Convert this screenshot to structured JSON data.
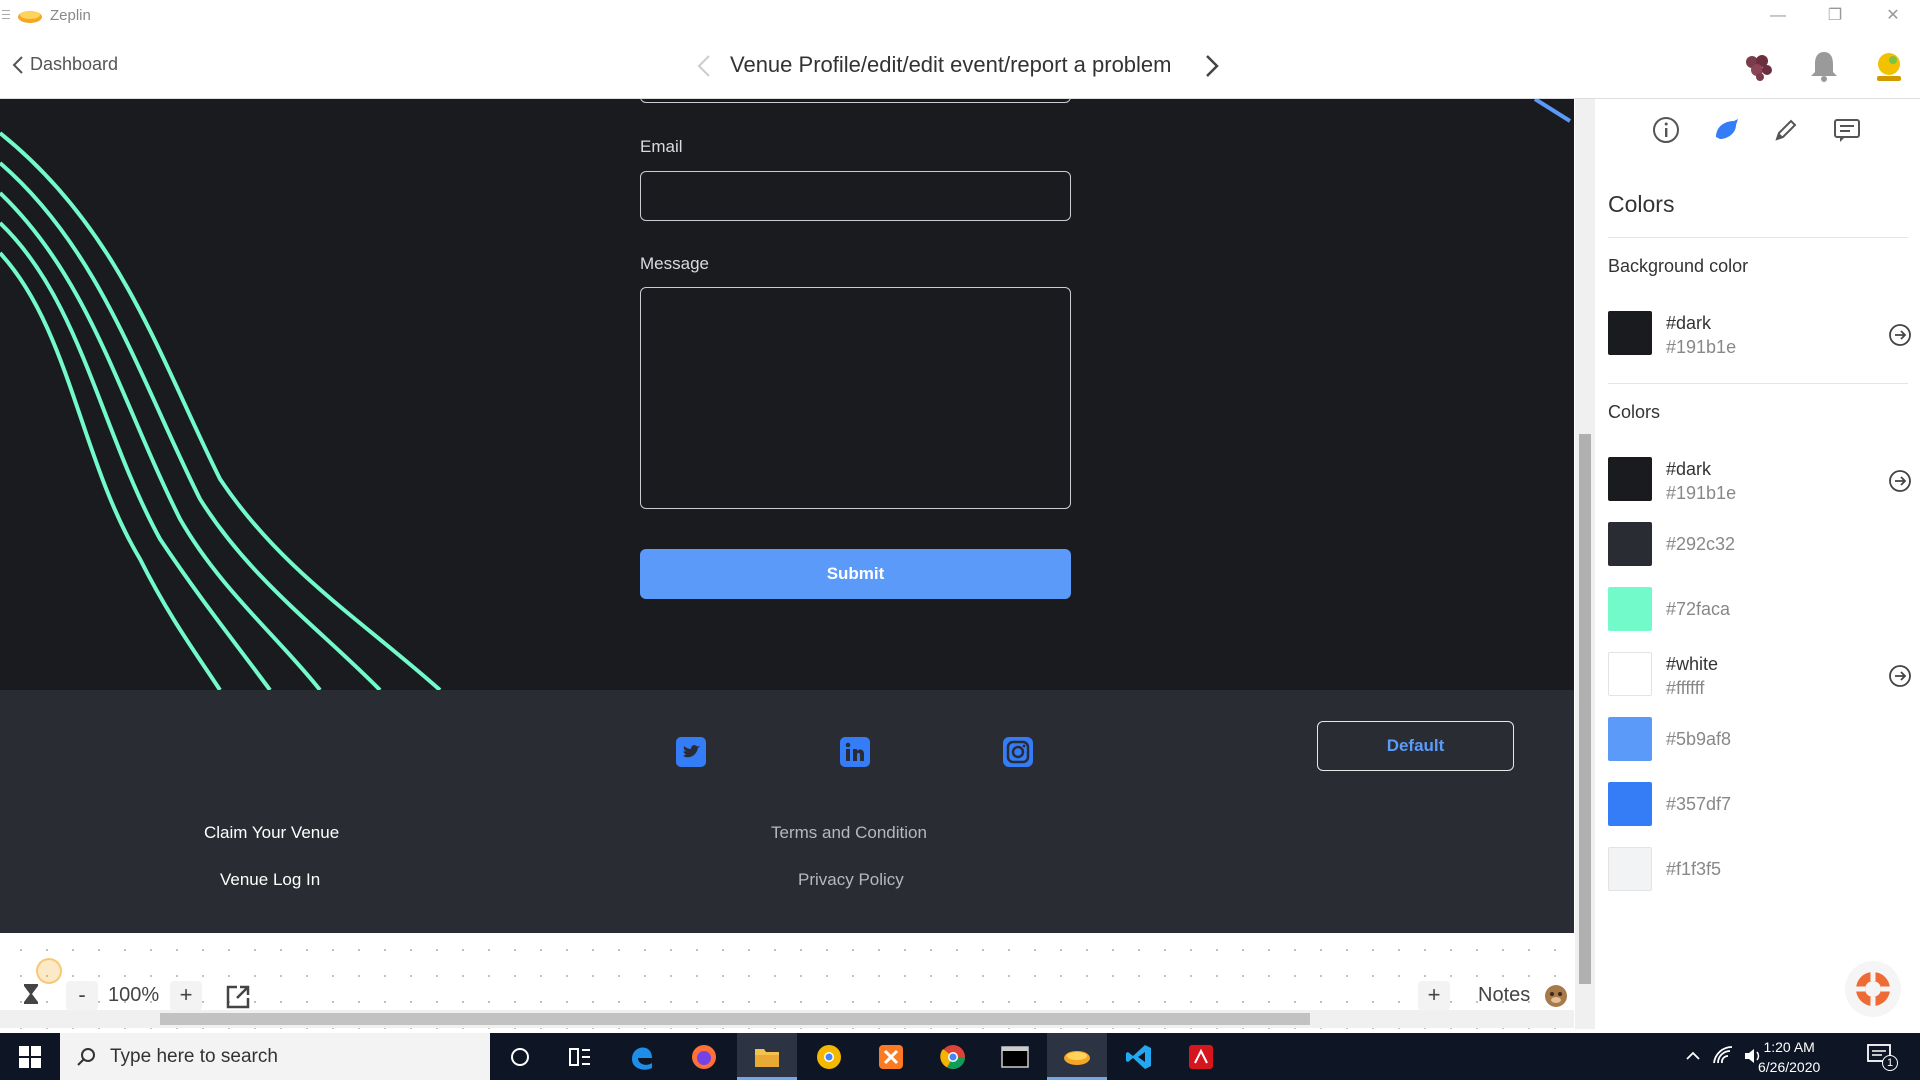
{
  "window": {
    "app_name": "Zeplin"
  },
  "header": {
    "back_label": "Dashboard",
    "breadcrumb": "Venue Profile/edit/edit event/report a problem"
  },
  "design": {
    "form": {
      "email_label": "Email",
      "email_value": "",
      "message_label": "Message",
      "message_value": "",
      "submit_label": "Submit"
    },
    "footer": {
      "social": [
        "twitter-icon",
        "linkedin-icon",
        "instagram-icon"
      ],
      "left_links": [
        "Claim Your Venue",
        "Venue Log In"
      ],
      "center_links": [
        "Terms and Condition",
        "Privacy Policy"
      ],
      "default_button_label": "Default"
    },
    "colors": {
      "background": "#191b1e",
      "footer": "#292c32",
      "accent": "#5b9af8",
      "wave": "#72faca"
    }
  },
  "toolbar": {
    "zoom": "100%",
    "minus": "-",
    "plus": "+",
    "notes_label": "Notes"
  },
  "panel": {
    "tabs": [
      "info-icon",
      "styleguide-icon",
      "pen-icon",
      "comment-icon"
    ],
    "title": "Colors",
    "background_section": "Background color",
    "background_color": {
      "name": "#dark",
      "hex": "#191b1e",
      "display_hex": "#191b1e"
    },
    "colors_section": "Colors",
    "colors": [
      {
        "name": "#dark",
        "hex": "#191b1e",
        "has_arrow": true
      },
      {
        "name": "",
        "hex": "#292c32",
        "has_arrow": false
      },
      {
        "name": "",
        "hex": "#72faca",
        "has_arrow": false
      },
      {
        "name": "#white",
        "hex": "#ffffff",
        "has_arrow": true
      },
      {
        "name": "",
        "hex": "#5b9af8",
        "has_arrow": false
      },
      {
        "name": "",
        "hex": "#357df7",
        "has_arrow": false
      },
      {
        "name": "",
        "hex": "#f1f3f5",
        "has_arrow": false
      }
    ]
  },
  "taskbar": {
    "search_placeholder": "Type here to search",
    "time": "1:20 AM",
    "date": "6/26/2020",
    "notification_count": "1"
  }
}
